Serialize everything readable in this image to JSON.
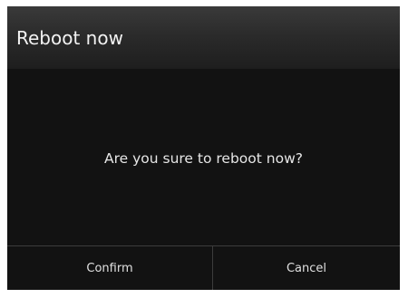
{
  "dialog": {
    "title": "Reboot now",
    "message": "Are you sure to reboot now?",
    "buttons": {
      "confirm_label": "Confirm",
      "cancel_label": "Cancel"
    }
  }
}
